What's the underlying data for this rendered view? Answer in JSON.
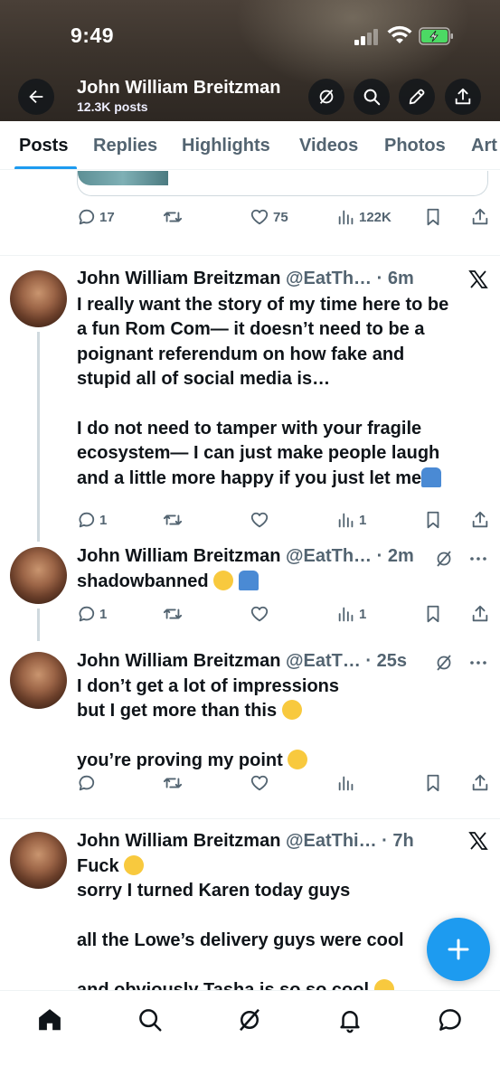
{
  "status_bar": {
    "time": "9:49"
  },
  "profile": {
    "name": "John William Breitzman",
    "post_count": "12.3K posts"
  },
  "tabs": [
    "Posts",
    "Replies",
    "Highlights",
    "Videos",
    "Photos",
    "Art"
  ],
  "active_tab": "Posts",
  "posts": [
    {
      "actions": {
        "replies": "17",
        "reposts": "",
        "likes": "75",
        "views": "122K"
      }
    },
    {
      "author": "John William Breitzman",
      "handle": "@EatTh…",
      "time": "· 6m",
      "lines": [
        "I really want the story of my time here to be",
        "a fun Rom Com— it doesn’t need to be a",
        "poignant referendum on how fake and",
        "stupid all of social media is…",
        "",
        "I do not need to tamper with your fragile",
        "ecosystem— I can just make people laugh",
        "and a little more happy if you just let me"
      ],
      "actions": {
        "replies": "1",
        "reposts": "",
        "likes": "",
        "views": "1"
      }
    },
    {
      "author": "John William Breitzman",
      "handle": "@EatTh…",
      "time": "· 2m",
      "lines": [
        "shadowbanned"
      ],
      "actions": {
        "replies": "1",
        "reposts": "",
        "likes": "",
        "views": "1"
      }
    },
    {
      "author": "John William Breitzman",
      "handle": "@EatT…",
      "time": "· 25s",
      "lines": [
        "I don’t get a lot of impressions",
        "but I get more than this",
        "",
        "you’re proving my point"
      ],
      "actions": {
        "replies": "",
        "reposts": "",
        "likes": "",
        "views": ""
      }
    },
    {
      "author": "John William Breitzman",
      "handle": "@EatThi…",
      "time": "· 7h",
      "lines": [
        "Fuck",
        "sorry I turned Karen today guys",
        "",
        "all the Lowe’s delivery guys were cool",
        "",
        "and obviously Tasha is so so cool"
      ]
    }
  ],
  "colors": {
    "accent": "#1d9bf0",
    "text": "#0f1419",
    "muted": "#536471"
  },
  "icons": [
    "back-arrow-icon",
    "grok-icon",
    "search-icon",
    "edit-icon",
    "share-icon",
    "reply-icon",
    "repost-icon",
    "like-icon",
    "views-icon",
    "bookmark-icon",
    "x-logo-icon",
    "more-icon",
    "plus-icon",
    "home-icon",
    "notifications-icon",
    "messages-icon"
  ]
}
